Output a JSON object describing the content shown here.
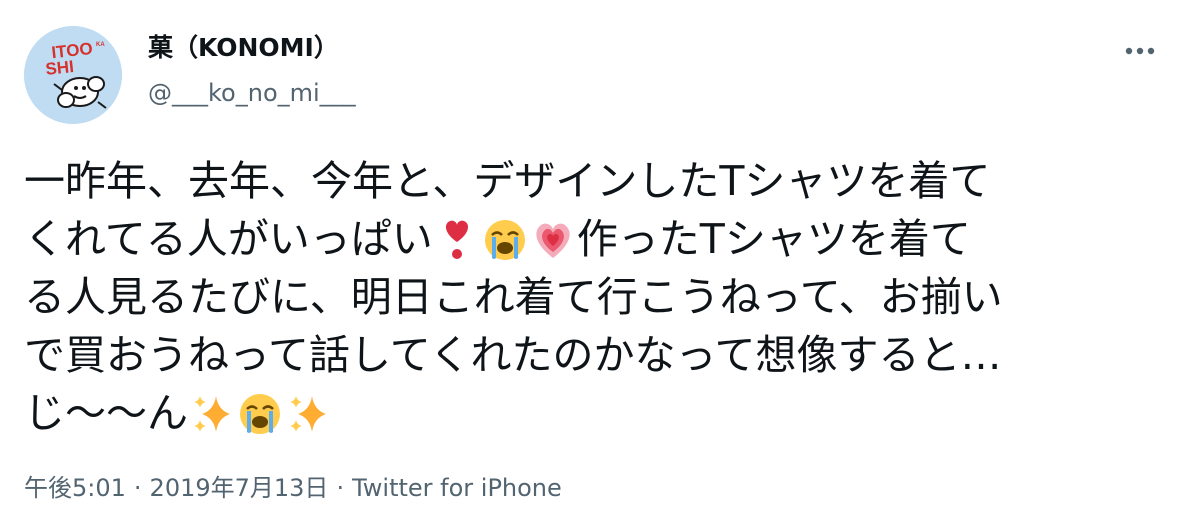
{
  "author": {
    "display_name": "菓（KONOMI）",
    "handle": "@___ko_no_mi___",
    "avatar_icon": "avatar-itooshi-logo",
    "avatar_text": "ITOOSHI",
    "avatar_bg": "#bfdcf2"
  },
  "tweet": {
    "lines": [
      "一昨年、去年、今年と、デザインしたTシャツを着て",
      "くれてる人がいっぱい",
      "作ったTシャツを着て",
      "る人見るたびに、明日これ着て行こうねって、お揃い",
      "で買おうねって話してくれたのかなって想像すると…",
      "じ〜〜ん"
    ],
    "emoji": {
      "heart_exclamation": "heavy-heart-exclamation-icon",
      "crying_face": "loudly-crying-face-icon",
      "growing_heart": "growing-heart-icon",
      "sparkles": "sparkles-icon"
    }
  },
  "meta": {
    "time": "午後5:01",
    "separator": "·",
    "date": "2019年7月13日",
    "source": "Twitter for iPhone"
  },
  "colors": {
    "text": "#0f1419",
    "secondary": "#536471",
    "avatar_red": "#d6312c"
  },
  "actions": {
    "more_icon": "more-options-icon"
  }
}
